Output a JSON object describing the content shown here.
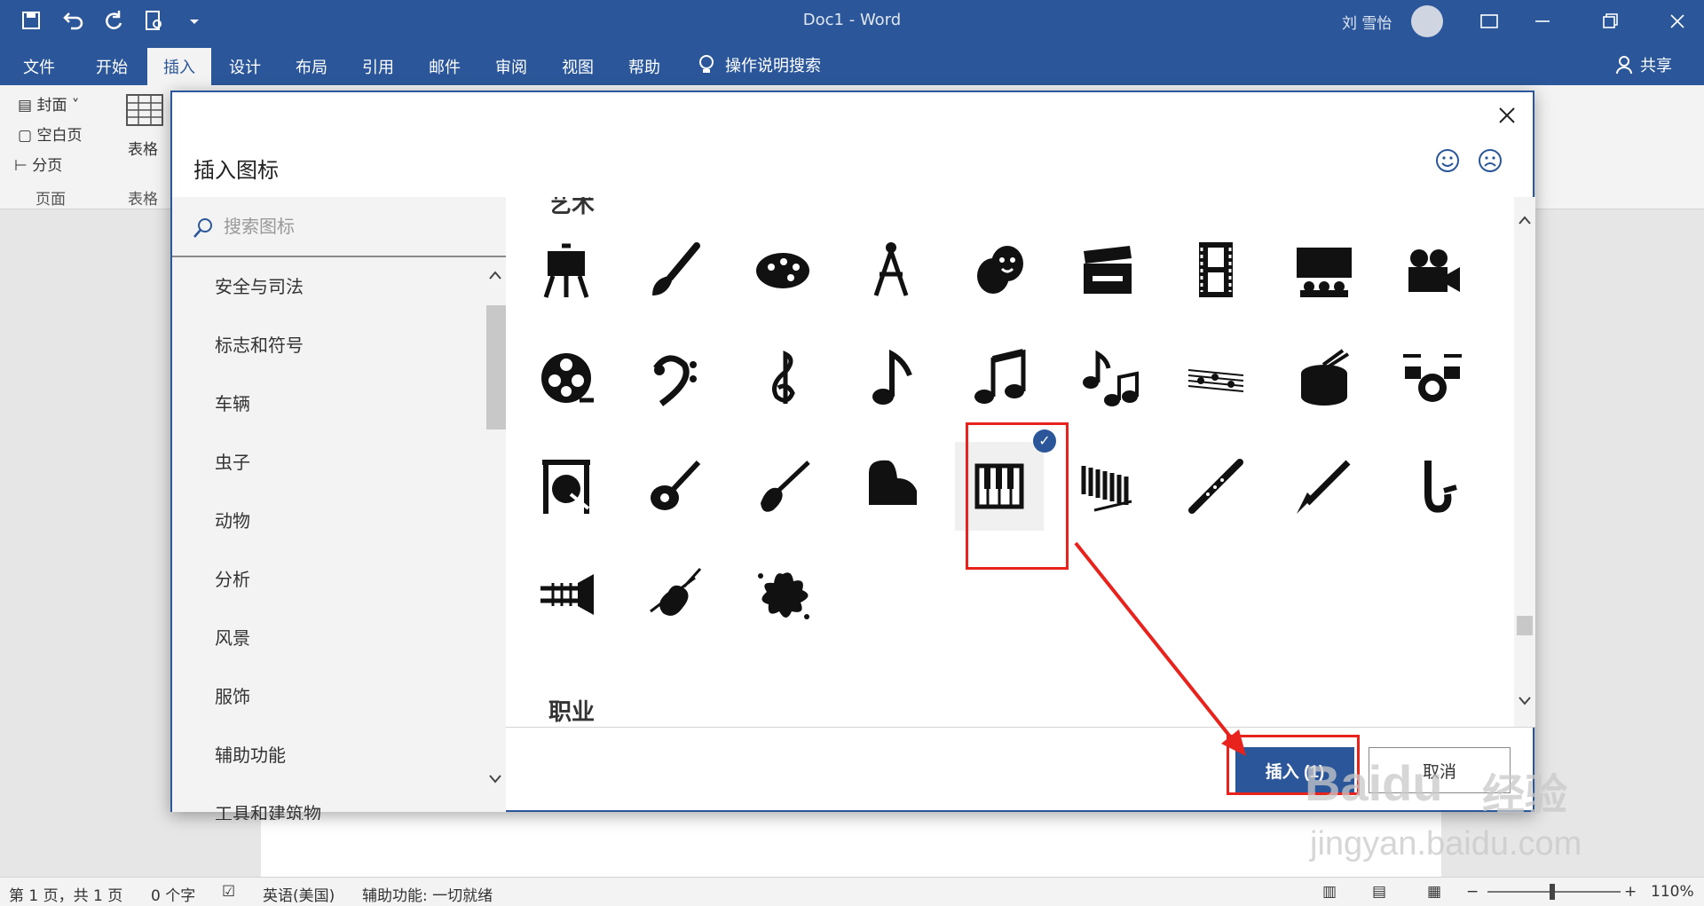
{
  "titlebar": {
    "title": "Doc1 - Word",
    "user": "刘 雪怡"
  },
  "tabs": [
    "文件",
    "开始",
    "插入",
    "设计",
    "布局",
    "引用",
    "邮件",
    "审阅",
    "视图",
    "帮助"
  ],
  "tellme": "操作说明搜索",
  "share": "共享",
  "ribbon": {
    "cover": "封面",
    "blank": "空白页",
    "break": "分页",
    "group_pages": "页面",
    "table": "表格",
    "group_table": "表格"
  },
  "dialog": {
    "title": "插入图标",
    "search_placeholder": "搜索图标",
    "categories": [
      "安全与司法",
      "标志和符号",
      "车辆",
      "虫子",
      "动物",
      "分析",
      "风景",
      "服饰",
      "辅助功能",
      "工具和建筑物"
    ],
    "section_top": "艺术",
    "section_bottom": "职业",
    "insert_label": "插入 (1)",
    "cancel_label": "取消",
    "icons": [
      "easel-icon",
      "paintbrush-icon",
      "palette-icon",
      "compass-icon",
      "theater-masks-icon",
      "clapperboard-icon",
      "film-strip-icon",
      "theater-audience-icon",
      "movie-camera-icon",
      "film-reel-icon",
      "bass-clef-icon",
      "treble-clef-icon",
      "eighth-note-icon",
      "beamed-notes-icon",
      "music-notes-icon",
      "sheet-music-icon",
      "drum-icon",
      "drum-kit-icon",
      "gong-icon",
      "acoustic-guitar-icon",
      "electric-guitar-icon",
      "grand-piano-icon",
      "piano-keys-icon",
      "xylophone-icon",
      "flute-icon",
      "clarinet-icon",
      "saxophone-icon",
      "trumpet-icon",
      "violin-icon",
      "paint-splat-icon"
    ],
    "selected_icon": "piano-keys-icon"
  },
  "status": {
    "page": "第 1 页，共 1 页",
    "words": "0 个字",
    "lang": "英语(美国)",
    "access": "辅助功能: 一切就绪",
    "zoom": "110%"
  },
  "watermark": {
    "brand": "Baidu",
    "product": "经验",
    "url": "jingyan.baidu.com"
  },
  "colors": {
    "accent": "#2b579a",
    "highlight": "#e8231e"
  }
}
